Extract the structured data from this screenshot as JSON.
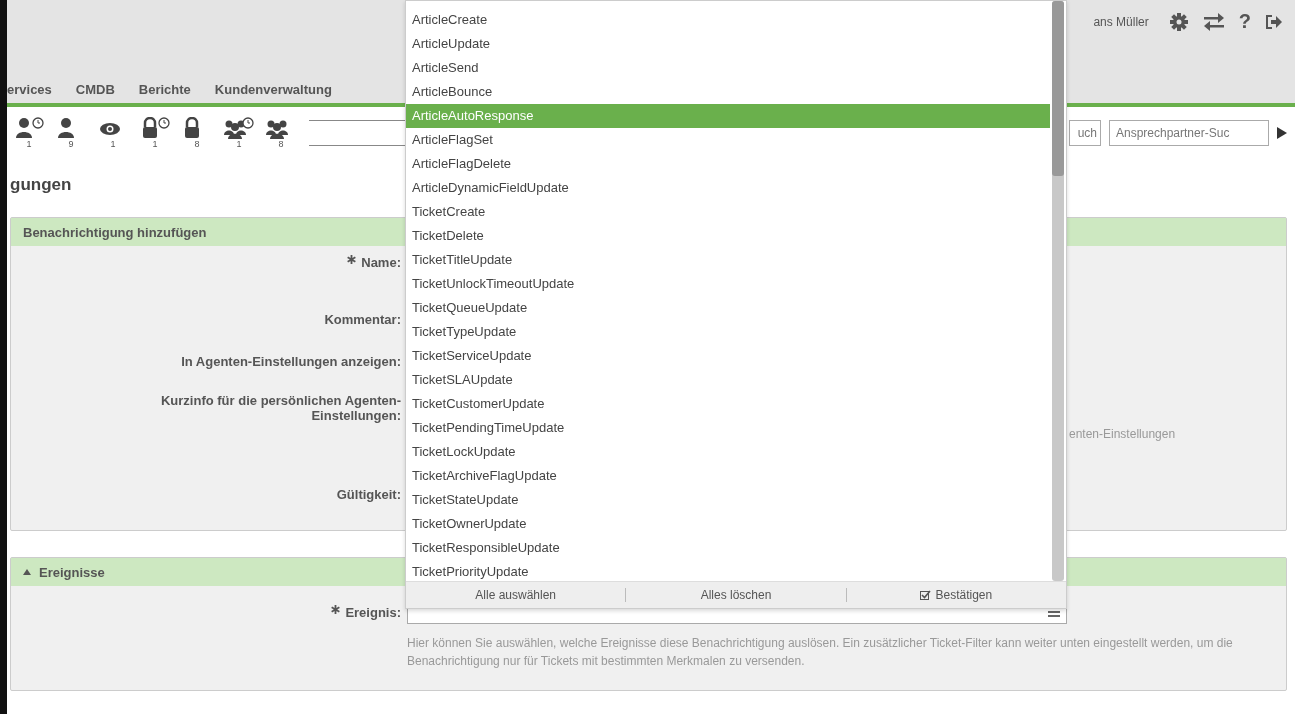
{
  "header": {
    "user": "ans Müller",
    "help": "?"
  },
  "nav": [
    {
      "label": "ervices"
    },
    {
      "label": "CMDB"
    },
    {
      "label": "Berichte"
    },
    {
      "label": "Kundenverwaltung"
    }
  ],
  "toolbar": [
    {
      "kind": "person-clock",
      "count": "1"
    },
    {
      "kind": "person",
      "count": "9"
    },
    {
      "kind": "eye",
      "count": "1"
    },
    {
      "kind": "lock-clock",
      "count": "1"
    },
    {
      "kind": "lock",
      "count": "8"
    },
    {
      "kind": "group-clock",
      "count": "1"
    },
    {
      "kind": "group",
      "count": "8"
    }
  ],
  "searches": [
    {
      "placeholder": "uch"
    },
    {
      "placeholder": "Ansprechpartner-Suc"
    }
  ],
  "page_title": "gungen",
  "panel": {
    "title": "Benachrichtigung hinzufügen",
    "fields": [
      {
        "label": "Name:",
        "required": true
      },
      {
        "label": "Kommentar:",
        "required": false
      },
      {
        "label": "In Agenten-Einstellungen anzeigen:",
        "required": false
      },
      {
        "label": "Kurzinfo für die persönlichen Agenten-Einstellungen:",
        "required": false,
        "value": "enten-Einstellungen"
      },
      {
        "label": "Gültigkeit:",
        "required": false
      }
    ]
  },
  "events_panel": {
    "title": "Ereignisse",
    "expanded": true,
    "field": {
      "label": "Ereignis:",
      "required": true
    },
    "help": "Hier können Sie auswählen, welche Ereignisse diese Benachrichtigung auslösen. Ein zusätzlicher Ticket-Filter kann weiter unten eingestellt werden, um die Benachrichtigung nur für Tickets mit bestimmten Merkmalen zu versenden."
  },
  "dropdown": {
    "options": [
      {
        "label": "ArticleCreate",
        "selected": false
      },
      {
        "label": "ArticleUpdate",
        "selected": false
      },
      {
        "label": "ArticleSend",
        "selected": false
      },
      {
        "label": "ArticleBounce",
        "selected": false
      },
      {
        "label": "ArticleAutoResponse",
        "selected": true
      },
      {
        "label": "ArticleFlagSet",
        "selected": false
      },
      {
        "label": "ArticleFlagDelete",
        "selected": false
      },
      {
        "label": "ArticleDynamicFieldUpdate",
        "selected": false
      },
      {
        "label": "TicketCreate",
        "selected": false
      },
      {
        "label": "TicketDelete",
        "selected": false
      },
      {
        "label": "TicketTitleUpdate",
        "selected": false
      },
      {
        "label": "TicketUnlockTimeoutUpdate",
        "selected": false
      },
      {
        "label": "TicketQueueUpdate",
        "selected": false
      },
      {
        "label": "TicketTypeUpdate",
        "selected": false
      },
      {
        "label": "TicketServiceUpdate",
        "selected": false
      },
      {
        "label": "TicketSLAUpdate",
        "selected": false
      },
      {
        "label": "TicketCustomerUpdate",
        "selected": false
      },
      {
        "label": "TicketPendingTimeUpdate",
        "selected": false
      },
      {
        "label": "TicketLockUpdate",
        "selected": false
      },
      {
        "label": "TicketArchiveFlagUpdate",
        "selected": false
      },
      {
        "label": "TicketStateUpdate",
        "selected": false
      },
      {
        "label": "TicketOwnerUpdate",
        "selected": false
      },
      {
        "label": "TicketResponsibleUpdate",
        "selected": false
      },
      {
        "label": "TicketPriorityUpdate",
        "selected": false
      }
    ],
    "actions": [
      {
        "label": "Alle auswählen",
        "kind": "plain"
      },
      {
        "label": "Alles löschen",
        "kind": "plain"
      },
      {
        "label": "Bestätigen",
        "kind": "confirm"
      }
    ]
  }
}
